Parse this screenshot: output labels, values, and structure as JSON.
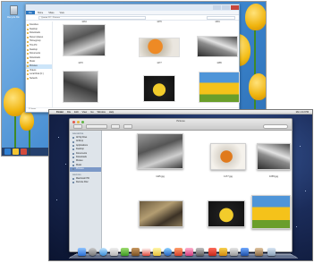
{
  "windows8": {
    "recycle_bin_label": "Recycle Bin",
    "explorer": {
      "ribbon_tabs": [
        "File",
        "Home",
        "Share",
        "View"
      ],
      "address": "Quarter PC › Pictures",
      "nav_items": [
        "Favorites",
        "Desktop",
        "Downloads",
        "Recent places",
        "Homegroup",
        "This PC",
        "Desktop",
        "Documents",
        "Downloads",
        "Music",
        "Pictures",
        "Videos",
        "Local Disk (C:)",
        "Network"
      ],
      "selected_nav": "Pictures",
      "thumb_labels_top": [
        "1234",
        "1276",
        "1301"
      ],
      "thumb_labels_bottom": [
        "1270",
        "1277",
        "1285"
      ],
      "status": "12 items"
    }
  },
  "mac": {
    "menubar": {
      "apple": "",
      "app": "Finder",
      "items": [
        "File",
        "Edit",
        "View",
        "Go",
        "Window",
        "Help"
      ],
      "clock": "Mon 4:13 PM"
    },
    "finder": {
      "title": "Pictures",
      "sidebar": {
        "favorites_header": "FAVORITES",
        "favorites": [
          "All My Files",
          "AirDrop",
          "Applications",
          "Desktop",
          "Documents",
          "Downloads",
          "Movies",
          "Music",
          "Pictures"
        ],
        "devices_header": "DEVICES",
        "devices": [
          "Macintosh HD",
          "Remote Disc"
        ],
        "selected": "Pictures"
      },
      "thumb_labels": [
        "1115.jpg",
        "1177.jpg",
        "1065.jpg"
      ]
    }
  },
  "colors": {
    "win_accent": "#2b76c0",
    "mac_selection": "#7b98c7",
    "tulip_yellow": "#f5c21a"
  }
}
